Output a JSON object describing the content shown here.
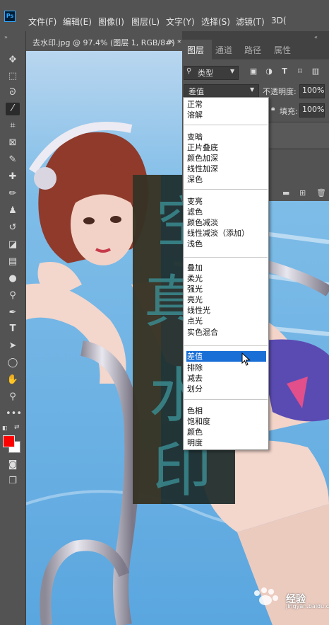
{
  "menubar": {
    "logo": "Ps",
    "items": [
      "文件(F)",
      "编辑(E)",
      "图像(I)",
      "图层(L)",
      "文字(Y)",
      "选择(S)",
      "滤镜(T)",
      "3D("
    ]
  },
  "document_tab": {
    "label": "去水印.jpg @ 97.4% (图层 1, RGB/8#) *",
    "close": "×"
  },
  "panel": {
    "tabs": [
      "图层",
      "通道",
      "路径",
      "属性"
    ],
    "filter": {
      "label": "类型"
    },
    "blend_mode": "差值",
    "opacity_label": "不透明度:",
    "opacity_value": "100%",
    "fill_label": "填充:",
    "fill_value": "100%"
  },
  "blend_menu": {
    "groups": [
      [
        "正常",
        "溶解"
      ],
      [
        "变暗",
        "正片叠底",
        "颜色加深",
        "线性加深",
        "深色"
      ],
      [
        "变亮",
        "滤色",
        "颜色减淡",
        "线性减淡（添加）",
        "浅色"
      ],
      [
        "叠加",
        "柔光",
        "强光",
        "亮光",
        "线性光",
        "点光",
        "实色混合"
      ],
      [
        "差值",
        "排除",
        "减去",
        "划分"
      ],
      [
        "色相",
        "饱和度",
        "颜色",
        "明度"
      ]
    ],
    "selected": "差值"
  },
  "canvas": {
    "watermark_chars": [
      "空",
      "真",
      "水",
      "印"
    ]
  },
  "watermark_site": {
    "text": "经验",
    "url": "jingyan.baidu.com"
  },
  "colors": {
    "foreground": "#ff0000",
    "background": "#ffffff",
    "accent": "#1a6fd6"
  },
  "icons": {
    "toolbar": [
      "move-icon",
      "marquee-icon",
      "lasso-icon",
      "magic-wand-icon",
      "crop-icon",
      "frame-icon",
      "eyedropper-icon",
      "healing-brush-icon",
      "brush-icon",
      "stamp-icon",
      "history-brush-icon",
      "eraser-icon",
      "gradient-icon",
      "blur-icon",
      "dodge-icon",
      "pen-icon",
      "type-icon",
      "path-select-icon",
      "ellipse-icon",
      "hand-icon",
      "zoom-icon",
      "more-icon",
      "quick-mask-icon",
      "screen-mode-icon"
    ]
  }
}
